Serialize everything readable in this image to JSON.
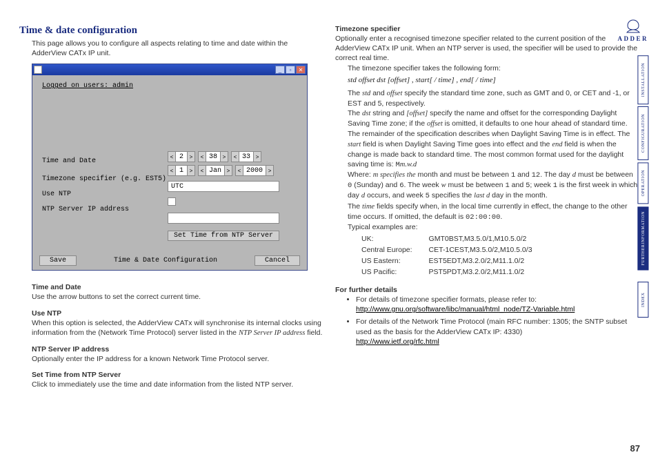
{
  "page_number": "87",
  "logo_brand": "ADDER",
  "heading": "Time & date configuration",
  "intro": "This page allows you to configure all aspects relating to time and date within the AdderView CATx IP unit.",
  "screenshot": {
    "logged_on": "Logged on users: admin",
    "label_time_date": "Time and Date",
    "label_tz": "Timezone specifier (e.g. EST5)",
    "label_use_ntp": "Use NTP",
    "label_ntp_ip": "NTP Server IP address",
    "time_vals": {
      "h": "2",
      "m": "38",
      "s": "33"
    },
    "date_vals": {
      "d": "1",
      "mon": "Jan",
      "y": "2000"
    },
    "tz_value": "UTC",
    "btn_set_ntp": "Set Time from NTP Server",
    "footer_title": "Time & Date Configuration",
    "btn_save": "Save",
    "btn_cancel": "Cancel"
  },
  "left": {
    "h_time_date": "Time and Date",
    "p_time_date": "Use the arrow buttons to set the correct current time.",
    "h_use_ntp": "Use NTP",
    "p_use_ntp_1": "When this option is selected, the AdderView CATx will synchronise its internal clocks using information from the (Network Time Protocol) server listed in the ",
    "p_use_ntp_em": "NTP Server IP address",
    "p_use_ntp_2": " field.",
    "h_ntp_ip": "NTP Server IP address",
    "p_ntp_ip": "Optionally enter the IP address for a known Network Time Protocol server.",
    "h_set_ntp": "Set Time from NTP Server",
    "p_set_ntp": "Click to immediately use the time and date information from the listed NTP server."
  },
  "right": {
    "h_tz": "Timezone specifier",
    "p_tz_intro": "Optionally enter a recognised timezone specifier related to the current position of the AdderView CATx IP unit. When an NTP server is used, the specifier will be used to provide the correct real time.",
    "p_tz_form": "The timezone specifier takes the following form:",
    "syntax": "std offset dst [offset] , start[ / time] , end[ / time]",
    "p_std_offset_1": "The ",
    "p_std_offset_em1": "std",
    "p_std_offset_2": " and ",
    "p_std_offset_em2": "offset",
    "p_std_offset_3": " specify the standard time zone, such as GMT and 0, or CET and -1, or EST and 5, respectively.",
    "p_dst_1": "The ",
    "p_dst_em1": "dst",
    "p_dst_2": " string and ",
    "p_dst_em2": "[offset]",
    "p_dst_3": " specify the name and offset for the corresponding Daylight Saving Time zone; if the ",
    "p_dst_em3": "offset",
    "p_dst_4": " is omitted, it defaults to one hour ahead of standard time.",
    "p_remainder_1": "The remainder of the specification describes when Daylight Saving Time is in effect. The ",
    "p_rem_em1": "start",
    "p_remainder_2": " field is when Daylight Saving Time goes into effect and the ",
    "p_rem_em2": "end",
    "p_remainder_3": " field is when the change is made back to standard time. The most common format used for the daylight saving time is: ",
    "p_rem_mono": "M",
    "p_rem_ital": "m.w.d",
    "p_where_1": "Where: ",
    "p_where_em1": "m specifies the",
    "p_where_2": " month and must be between ",
    "p_where_m1": "1",
    "p_where_3": " and ",
    "p_where_m2": "12",
    "p_where_4": ". The day ",
    "p_where_em2": "d",
    "p_where_5": " must be between ",
    "p_where_m3": "0",
    "p_where_6": " (Sunday) and ",
    "p_where_m4": "6",
    "p_where_7": ". The week ",
    "p_where_em3": "w",
    "p_where_8": " must be between ",
    "p_where_m5": "1",
    "p_where_9": " and ",
    "p_where_m6": "5",
    "p_where_10": "; week ",
    "p_where_m7": "1",
    "p_where_11": " is the first week in which day ",
    "p_where_em4": "d",
    "p_where_12": " occurs, and week ",
    "p_where_m8": "5",
    "p_where_13": " specifies the ",
    "p_where_em5": "last d",
    "p_where_14": " day in the month.",
    "p_time_1": "The ",
    "p_time_em": "time",
    "p_time_2": " fields specify when, in the local time currently in effect, the change to the other time occurs. If omitted, the default is ",
    "p_time_mono": "02:00:00",
    "p_time_3": ".",
    "p_examples_label": "Typical examples are:",
    "examples": [
      {
        "region": "UK:",
        "spec": "GMT0BST,M3.5.0/1,M10.5.0/2"
      },
      {
        "region": "Central Europe:",
        "spec": "CET-1CEST,M3.5.0/2,M10.5.0/3"
      },
      {
        "region": "US Eastern:",
        "spec": "EST5EDT,M3.2.0/2,M11.1.0/2"
      },
      {
        "region": "US Pacific:",
        "spec": "PST5PDT,M3.2.0/2,M11.1.0/2"
      }
    ],
    "h_further": "For further details",
    "li1_text": "For details of timezone specifier formats, please refer to:",
    "li1_url": "http://www.gnu.org/software/libc/manual/html_node/TZ-Variable.html",
    "li2_text": "For details of the Network Time Protocol (main RFC number: 1305; the SNTP subset used as the basis for the AdderView CATx IP: 4330)",
    "li2_url": "http://www.ietf.org/rfc.html"
  },
  "tabs": {
    "installation": "installation",
    "configuration": "configuration",
    "operation": "operation",
    "further1": "further",
    "further2": "information",
    "index": "index"
  }
}
